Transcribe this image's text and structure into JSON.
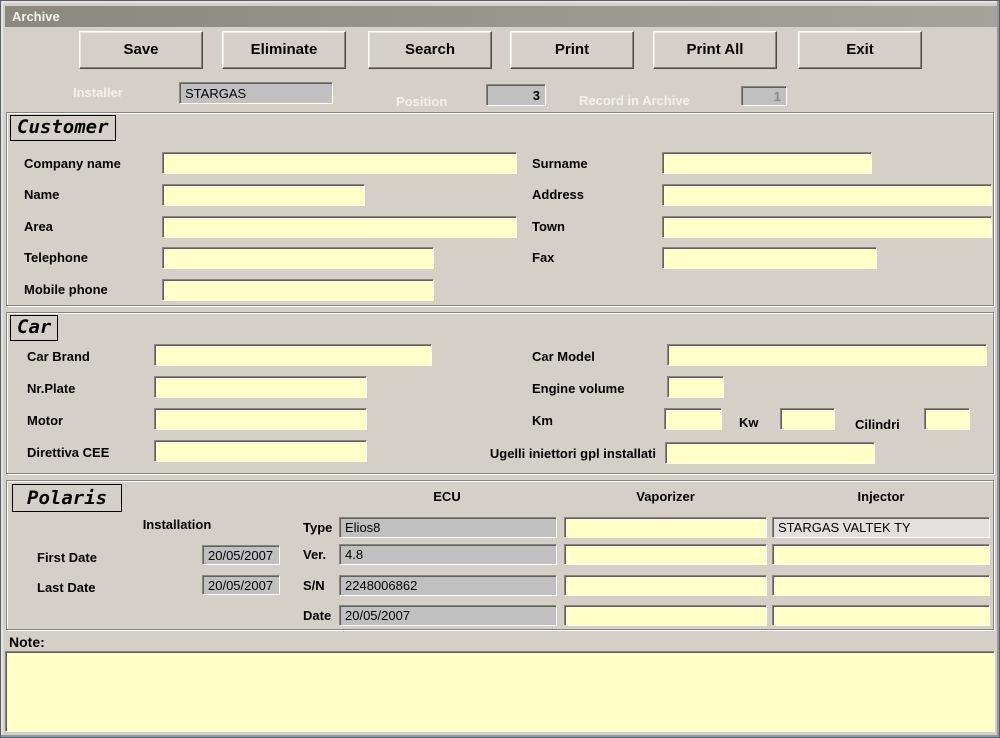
{
  "window": {
    "title": "Archive"
  },
  "toolbar": {
    "save": "Save",
    "eliminate": "Eliminate",
    "search": "Search",
    "print": "Print",
    "print_all": "Print All",
    "exit": "Exit"
  },
  "header": {
    "installer_label": "Installer",
    "installer_value": "STARGAS",
    "position_label": "Position",
    "position_value": "3",
    "record_label": "Record in Archive",
    "record_value": "1"
  },
  "customer": {
    "section_title": "Customer",
    "labels": {
      "company": "Company name",
      "surname": "Surname",
      "name": "Name",
      "address": "Address",
      "area": "Area",
      "town": "Town",
      "telephone": "Telephone",
      "fax": "Fax",
      "mobile": "Mobile phone"
    },
    "values": {
      "company": "",
      "surname": "",
      "name": "",
      "address": "",
      "area": "",
      "town": "",
      "telephone": "",
      "fax": "",
      "mobile": ""
    }
  },
  "car": {
    "section_title": "Car",
    "labels": {
      "brand": "Car Brand",
      "model": "Car Model",
      "plate": "Nr.Plate",
      "engine_volume": "Engine volume",
      "motor": "Motor",
      "km": "Km",
      "kw": "Kw",
      "cilindri": "Cilindri",
      "direttiva": "Direttiva CEE",
      "ugelli": "Ugelli iniettori gpl installati"
    },
    "values": {
      "brand": "",
      "model": "",
      "plate": "",
      "engine_volume": "",
      "motor": "",
      "km": "",
      "kw": "",
      "cilindri": "",
      "direttiva": "",
      "ugelli": ""
    }
  },
  "polaris": {
    "section_title": "Polaris",
    "installation_label": "Installation",
    "columns": {
      "ecu": "ECU",
      "vaporizer": "Vaporizer",
      "injector": "Injector"
    },
    "first_date_label": "First Date",
    "first_date_value": "20/05/2007",
    "last_date_label": "Last Date",
    "last_date_value": "20/05/2007",
    "row_labels": {
      "type": "Type",
      "ver": "Ver.",
      "sn": "S/N",
      "date": "Date"
    },
    "ecu": {
      "type": "Elios8",
      "ver": "4.8",
      "sn": "2248006862",
      "date": "20/05/2007"
    },
    "vaporizer": {
      "type": "",
      "ver": "",
      "sn": "",
      "date": ""
    },
    "injector": {
      "type": "STARGAS VALTEK TY",
      "ver": "",
      "sn": "",
      "date": ""
    }
  },
  "note": {
    "label": "Note:",
    "value": ""
  },
  "colors": {
    "form_background": "#D4D0C8",
    "field_yellow": "#FFFFC8",
    "field_gray": "#C0C0C0",
    "titlebar_gray": "#8f8d85"
  }
}
